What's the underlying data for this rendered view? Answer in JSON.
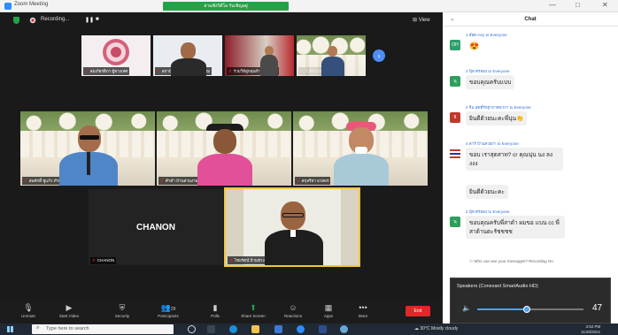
{
  "window": {
    "title": "Zoom Meeting",
    "share_banner": "ล่ามฟังวิดีโอ รับเชิญอยู่",
    "controls": [
      "—",
      "□",
      "✕"
    ]
  },
  "meeting": {
    "recording_label": "Recording...",
    "view_label": "View",
    "next_page": "›",
    "top_row": [
      {
        "name": "สมเกียรติภา ผู้ทางเทศ"
      },
      {
        "name": "สถาบันภาษาไทย วัฒนธรรม"
      },
      {
        "name": "ร่วมวิธีสู่กลุ่มสำราญวิวาห"
      },
      {
        "name": "วิเชียร ผู้ช่วย ครูด"
      }
    ],
    "middle_row": [
      {
        "name": "สมศักดิ์ ชูแก้ว ทำเนยง"
      },
      {
        "name": "คำดำ บ้านสวนงาม"
      },
      {
        "name": "สกุลรีหา อวยพร"
      }
    ],
    "bottom_row": [
      {
        "name": "CHANON",
        "display": "CHANON"
      },
      {
        "name": "ไชยรัตน์ บ้านช่าง"
      }
    ]
  },
  "toolbar": {
    "items": [
      {
        "label": "Unmute",
        "icon": "microphone-icon",
        "glyph": "🎙"
      },
      {
        "label": "Start Video",
        "icon": "video-icon",
        "glyph": "▶"
      },
      {
        "label": "Security",
        "icon": "shield-icon",
        "glyph": "⛨"
      },
      {
        "label": "Participants",
        "icon": "participants-icon",
        "glyph": "👥",
        "count": "29"
      },
      {
        "label": "Polls",
        "icon": "polls-icon",
        "glyph": "▮"
      },
      {
        "label": "Share Screen",
        "icon": "share-screen-icon",
        "glyph": "⬆"
      },
      {
        "label": "Reactions",
        "icon": "reactions-icon",
        "glyph": "☺"
      },
      {
        "label": "Apps",
        "icon": "apps-icon",
        "glyph": "▦"
      },
      {
        "label": "More",
        "icon": "more-icon",
        "glyph": "•••"
      }
    ],
    "end_label": "End"
  },
  "chat": {
    "title": "Chat",
    "messages": [
      {
        "from": "1 อ๊อด Hoy to Everyone",
        "text": "😍",
        "avatar_text": "OH",
        "avatar_color": "#2f9e6b"
      },
      {
        "from": "2 นุ๊ท ศรทอง to Everyone",
        "text": "ขอบคุณครับแบบ",
        "avatar_text": "นุ",
        "avatar_color": "#2e9e5b"
      },
      {
        "from": "4 จิน สุดที่รักฐาภาคยากา to Everyone",
        "text": "ยินดีด้วยนะคะพี่นุ่น👏",
        "avatar_text": "จิ",
        "avatar_color": "#c0392b"
      },
      {
        "from": "4 ดาร์ บ้านสวยกา to Everyone",
        "text": "ขอบ เราสุดสาท? cr คุณนุ่น นง ลงงงง",
        "avatar_text": "",
        "avatar_color": "#ffffff"
      },
      {
        "from": "",
        "text": "ยินดีด้วยนะคะ",
        "avatar_text": "",
        "avatar_color": "#ffffff"
      },
      {
        "from": "2 นุ๊ท ศรทอง to Everyone",
        "text": "ขอบคุณครับพี่สาดำ ผมขอ แบน cc พี่สาด้านตะรัชชชช",
        "avatar_text": "นุ",
        "avatar_color": "#2e9e5b"
      }
    ],
    "visibility_note": "Who can see your messages? Recording On"
  },
  "speakers": {
    "title": "Speakers (Conexant SmartAudio HD)",
    "volume": 47,
    "volume_label": "47"
  },
  "taskbar": {
    "search_placeholder": "Type here to search",
    "weather": "30°C  Mostly cloudy",
    "time": "3:52 PM",
    "date": "11/28/2021"
  }
}
